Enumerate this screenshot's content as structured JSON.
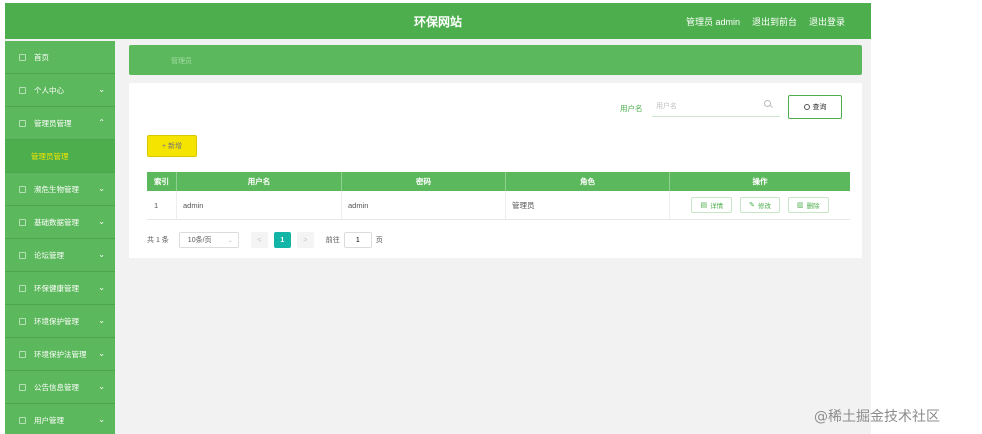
{
  "header": {
    "title": "环保网站",
    "user_label": "管理员 admin",
    "exit_to_front": "退出到前台",
    "logout": "退出登录"
  },
  "sidebar": {
    "items": [
      {
        "label": "首页",
        "expandable": false
      },
      {
        "label": "个人中心",
        "expandable": true
      },
      {
        "label": "管理员管理",
        "expandable": true,
        "expanded": true
      },
      {
        "label": "濒危生物管理",
        "expandable": true
      },
      {
        "label": "基础数据管理",
        "expandable": true
      },
      {
        "label": "论坛管理",
        "expandable": true
      },
      {
        "label": "环保健康管理",
        "expandable": true
      },
      {
        "label": "环境保护管理",
        "expandable": true
      },
      {
        "label": "环境保护法管理",
        "expandable": true
      },
      {
        "label": "公告信息管理",
        "expandable": true
      },
      {
        "label": "用户管理",
        "expandable": true
      }
    ],
    "active_sub_item": "管理员管理"
  },
  "breadcrumb": {
    "current": "管理员"
  },
  "search": {
    "label": "用户名",
    "placeholder": "用户名",
    "button": "查询"
  },
  "toolbar": {
    "add_label": "+ 新增"
  },
  "table": {
    "columns": [
      "索引",
      "用户名",
      "密码",
      "角色",
      "操作"
    ],
    "rows": [
      {
        "index": "1",
        "username": "admin",
        "password": "admin",
        "role": "管理员"
      }
    ],
    "actions": {
      "detail": "详情",
      "edit": "修改",
      "delete": "删除"
    }
  },
  "pagination": {
    "total_text": "共 1 条",
    "page_size": "10条/页",
    "prev": "<",
    "current_page": "1",
    "next": ">",
    "goto_label": "前往",
    "goto_value": "1",
    "page_unit": "页"
  },
  "watermark": "@稀土掘金技术社区",
  "colors": {
    "header_green": "#4cae4c",
    "sidebar_green": "#5cb85c",
    "add_yellow": "#f5e300",
    "active_sub_text": "#f5e500",
    "pager_current": "#13b5a6"
  }
}
